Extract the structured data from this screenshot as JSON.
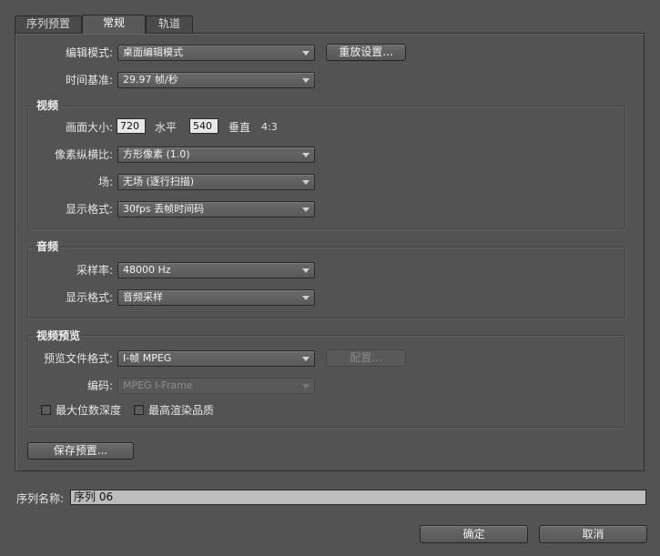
{
  "tabs": [
    {
      "label": "序列预置"
    },
    {
      "label": "常规"
    },
    {
      "label": "轨道"
    }
  ],
  "general": {
    "edit_mode_label": "编辑模式:",
    "edit_mode_value": "桌面编辑模式",
    "reset_button": "重放设置...",
    "timebase_label": "时间基准:",
    "timebase_value": "29.97 帧/秒"
  },
  "video": {
    "heading": "视频",
    "frame_size_label": "画面大小:",
    "frame_width": "720",
    "horizontal_label": "水平",
    "frame_height": "540",
    "vertical_label": "垂直",
    "aspect": "4:3",
    "pixel_aspect_label": "像素纵横比:",
    "pixel_aspect_value": "方形像素 (1.0)",
    "fields_label": "场:",
    "fields_value": "无场 (逐行扫描)",
    "display_format_label": "显示格式:",
    "display_format_value": "30fps 丢帧时间码"
  },
  "audio": {
    "heading": "音频",
    "sample_rate_label": "采样率:",
    "sample_rate_value": "48000 Hz",
    "display_format_label": "显示格式:",
    "display_format_value": "音频采样"
  },
  "preview": {
    "heading": "视频预览",
    "file_format_label": "预览文件格式:",
    "file_format_value": "I-帧 MPEG",
    "configure_button": "配置...",
    "codec_label": "编码:",
    "codec_value": "MPEG I-Frame",
    "max_bit_depth_label": "最大位数深度",
    "max_render_quality_label": "最高渲染品质"
  },
  "save_preset_button": "保存预置...",
  "sequence_name_label": "序列名称:",
  "sequence_name_value": "序列 06",
  "ok_button": "确定",
  "cancel_button": "取消"
}
